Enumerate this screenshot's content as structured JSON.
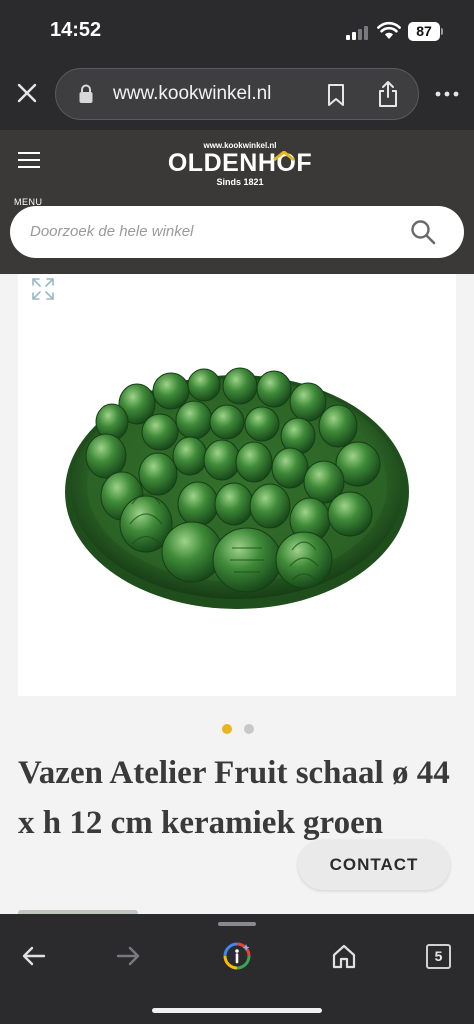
{
  "status_bar": {
    "time": "14:52",
    "battery": "87"
  },
  "browser": {
    "url": "www.kookwinkel.nl",
    "open_tabs": "5"
  },
  "site": {
    "menu_label": "MENU",
    "logo": {
      "url": "www.kookwinkel.nl",
      "name": "OLDENHOF",
      "since": "Sinds 1821"
    },
    "search_placeholder": "Doorzoek de hele winkel"
  },
  "product": {
    "title": "Vazen Atelier Fruit schaal ø 44 x h 12 cm keramiek groen",
    "gallery": {
      "image_count": 2,
      "active_index": 0,
      "active_color": "#e8b520",
      "inactive_color": "#c8c8c8"
    },
    "contact_label": "CONTACT"
  },
  "icons": {
    "close": "close-icon",
    "lock": "lock-icon",
    "bookmark": "bookmark-icon",
    "share": "share-icon",
    "more": "more-icon",
    "menu": "hamburger-icon",
    "search": "search-icon",
    "zoom": "expand-icon",
    "back": "back-arrow-icon",
    "forward": "forward-arrow-icon",
    "assistant": "google-assistant-icon",
    "home": "home-icon"
  },
  "colors": {
    "header_bg": "#3b3937",
    "browser_bg": "#2b2b2d",
    "content_bg": "#f3f3f3",
    "accent": "#e8b520",
    "glaze_green": "#2e6b2a"
  }
}
